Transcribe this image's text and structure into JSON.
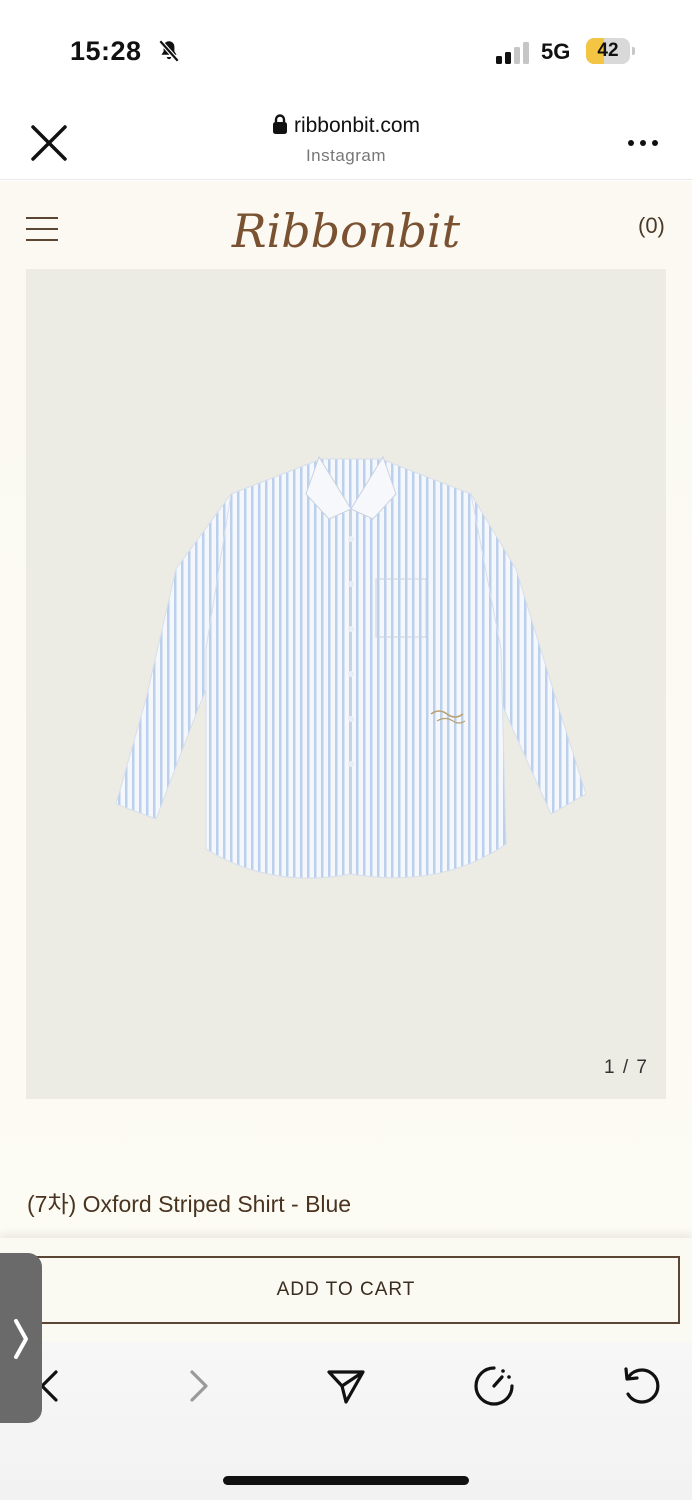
{
  "status_bar": {
    "time": "15:28",
    "network": "5G",
    "battery_level": "42",
    "battery_fraction": 0.42,
    "icons": [
      "bell-slash-icon",
      "signal-icon",
      "battery-icon"
    ]
  },
  "browser": {
    "domain": "ribbonbit.com",
    "source": "Instagram",
    "icons": [
      "close-icon",
      "lock-icon",
      "more-icon"
    ]
  },
  "site": {
    "logo_text": "Ribbonbit",
    "cart_count": "(0)",
    "brand_color": "#5a4632",
    "product": {
      "image_counter": "1 / 7",
      "title": "(7차) Oxford Striped Shirt - Blue"
    },
    "add_to_cart_label": "ADD TO CART"
  },
  "toolbar": {
    "icons": [
      "back-icon",
      "forward-icon",
      "share-icon",
      "speed-icon",
      "reload-icon",
      "side-panel-chevron-icon"
    ]
  }
}
